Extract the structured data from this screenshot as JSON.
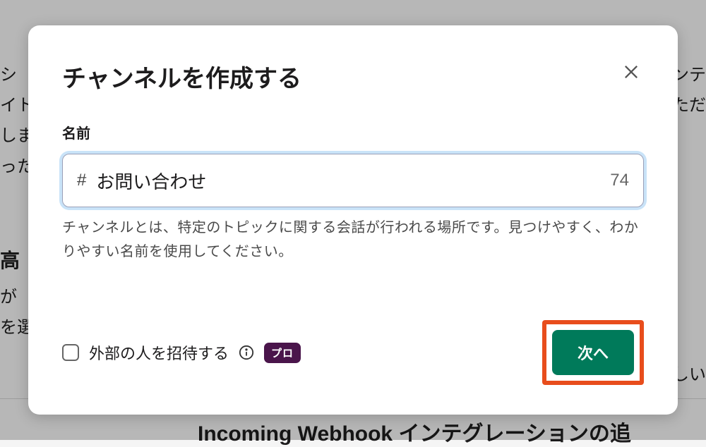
{
  "background": {
    "left1": "シ\nイト\nしま\nった",
    "left2": "高",
    "left3": "が\nを選",
    "right1": "ンテ\nただ",
    "right2": "しい",
    "bottom": "Incoming Webhook インテグレーションの追"
  },
  "modal": {
    "title": "チャンネルを作成する",
    "name_label": "名前",
    "hash": "#",
    "name_value": "お問い合わせ",
    "char_count": "74",
    "helper": "チャンネルとは、特定のトピックに関する会話が行われる場所です。見つけやすく、わかりやすい名前を使用してください。",
    "invite_label": "外部の人を招待する",
    "pro_badge": "プロ",
    "next_label": "次へ"
  }
}
